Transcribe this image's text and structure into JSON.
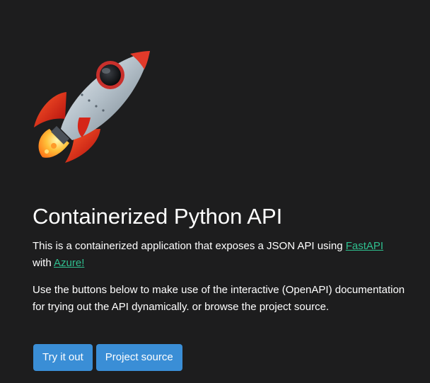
{
  "hero": {
    "icon": "rocket-icon",
    "title": "Containerized Python API"
  },
  "intro": {
    "text_before_link": "This is a containerized application that exposes a JSON API using ",
    "fastapi_link": "FastAPI",
    "text_between": " with ",
    "azure_link": "Azure!"
  },
  "description": "Use the buttons below to make use of the interactive (OpenAPI) documentation for trying out the API dynamically. or browse the project source.",
  "buttons": {
    "try_label": "Try it out",
    "source_label": "Project source"
  },
  "colors": {
    "background": "#1d1d1e",
    "link": "#2fbf8f",
    "button": "#3a8ed6"
  }
}
